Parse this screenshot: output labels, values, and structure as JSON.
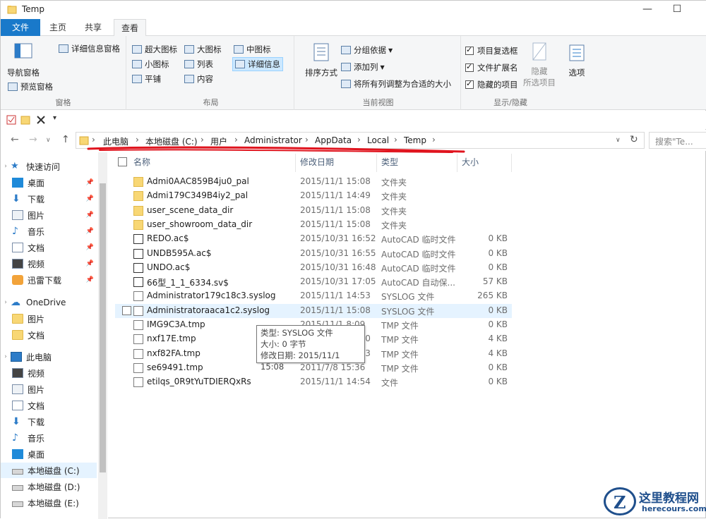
{
  "window": {
    "title": "Temp"
  },
  "window_controls": {
    "minimize": "—",
    "maximize": "☐"
  },
  "tabs": [
    {
      "label": "文件"
    },
    {
      "label": "主页"
    },
    {
      "label": "共享"
    },
    {
      "label": "查看"
    }
  ],
  "ribbon": {
    "pane_group": {
      "nav_pane": "导航窗格",
      "preview_pane": "预览窗格",
      "details_pane": "详细信息窗格",
      "label": "窗格"
    },
    "layout_group": {
      "items": [
        "超大图标",
        "大图标",
        "中图标",
        "小图标",
        "列表",
        "详细信息",
        "平铺",
        "内容"
      ],
      "label": "布局"
    },
    "view_group": {
      "sort_by": "排序方式",
      "group_by": "分组依据",
      "add_column": "添加列",
      "fit_columns": "将所有列调整为合适的大小",
      "label": "当前视图"
    },
    "show_group": {
      "item_checkboxes": "项目复选框",
      "file_extensions": "文件扩展名",
      "hidden_items": "隐藏的项目",
      "hide_selected_1": "隐藏",
      "hide_selected_2": "所选项目",
      "options": "选项",
      "label": "显示/隐藏"
    }
  },
  "qat": {
    "arrow": "▾"
  },
  "address": {
    "crumbs": [
      "此电脑",
      "本地磁盘 (C:)",
      "用户",
      "Administrator",
      "AppData",
      "Local",
      "Temp"
    ],
    "search_placeholder": "搜索\"Te..."
  },
  "nav": {
    "quick_access": "快速访问",
    "quick_items": [
      "桌面",
      "下载",
      "图片",
      "音乐",
      "文档",
      "视频",
      "迅雷下载"
    ],
    "onedrive": "OneDrive",
    "onedrive_items": [
      "图片",
      "文档"
    ],
    "this_pc": "此电脑",
    "pc_items": [
      "视频",
      "图片",
      "文档",
      "下载",
      "音乐",
      "桌面",
      "本地磁盘 (C:)",
      "本地磁盘 (D:)",
      "本地磁盘 (E:)"
    ]
  },
  "columns": {
    "name": "名称",
    "date": "修改日期",
    "type": "类型",
    "size": "大小"
  },
  "files": [
    {
      "name": "Admi0AAC859B4ju0_pal",
      "date": "2015/11/1 15:08",
      "type": "文件夹",
      "size": "",
      "kind": "folder"
    },
    {
      "name": "Admi179C349B4iy2_pal",
      "date": "2015/11/1 14:49",
      "type": "文件夹",
      "size": "",
      "kind": "folder"
    },
    {
      "name": "user_scene_data_dir",
      "date": "2015/11/1 15:08",
      "type": "文件夹",
      "size": "",
      "kind": "folder"
    },
    {
      "name": "user_showroom_data_dir",
      "date": "2015/11/1 15:08",
      "type": "文件夹",
      "size": "",
      "kind": "folder"
    },
    {
      "name": "REDO.ac$",
      "date": "2015/10/31 16:52",
      "type": "AutoCAD 临时文件",
      "size": "0 KB",
      "kind": "acad"
    },
    {
      "name": "UNDB595A.ac$",
      "date": "2015/10/31 16:55",
      "type": "AutoCAD 临时文件",
      "size": "0 KB",
      "kind": "acad"
    },
    {
      "name": "UNDO.ac$",
      "date": "2015/10/31 16:48",
      "type": "AutoCAD 临时文件",
      "size": "0 KB",
      "kind": "acad"
    },
    {
      "name": "66型_1_1_6334.sv$",
      "date": "2015/10/31 17:05",
      "type": "AutoCAD 自动保...",
      "size": "57 KB",
      "kind": "acad"
    },
    {
      "name": "Administrator179c18c3.syslog",
      "date": "2015/11/1 14:53",
      "type": "SYSLOG 文件",
      "size": "265 KB",
      "kind": "file"
    },
    {
      "name": "Administratoraaca1c2.syslog",
      "date": "2015/11/1 15:08",
      "type": "SYSLOG 文件",
      "size": "0 KB",
      "kind": "file"
    },
    {
      "name": "IMG9C3A.tmp",
      "date": "2015/11/1 8:09",
      "type": "TMP 文件",
      "size": "0 KB",
      "kind": "file"
    },
    {
      "name": "nxf17E.tmp",
      "date": "2015/11/1 14:50",
      "type": "TMP 文件",
      "size": "4 KB",
      "kind": "file"
    },
    {
      "name": "nxf82FA.tmp",
      "date": "2015/11/1 14:53",
      "type": "TMP 文件",
      "size": "4 KB",
      "kind": "file"
    },
    {
      "name": "se69491.tmp",
      "date": "2011/7/8 15:36",
      "type": "TMP 文件",
      "size": "0 KB",
      "kind": "file"
    },
    {
      "name": "etilqs_0R9tYuTDIERQxRs",
      "date": "2015/11/1 14:54",
      "type": "文件",
      "size": "0 KB",
      "kind": "file"
    }
  ],
  "tooltip": {
    "line1": "类型: SYSLOG 文件",
    "line2": "大小: 0 字节",
    "line3": "修改日期: 2015/11/1 15:08"
  },
  "watermark": {
    "cn": "这里教程网",
    "en": "herecours.com",
    "logo": "Z"
  },
  "colors": {
    "accent": "#1979ca",
    "annotation": "#e0141e",
    "hover": "#e5f3ff"
  }
}
